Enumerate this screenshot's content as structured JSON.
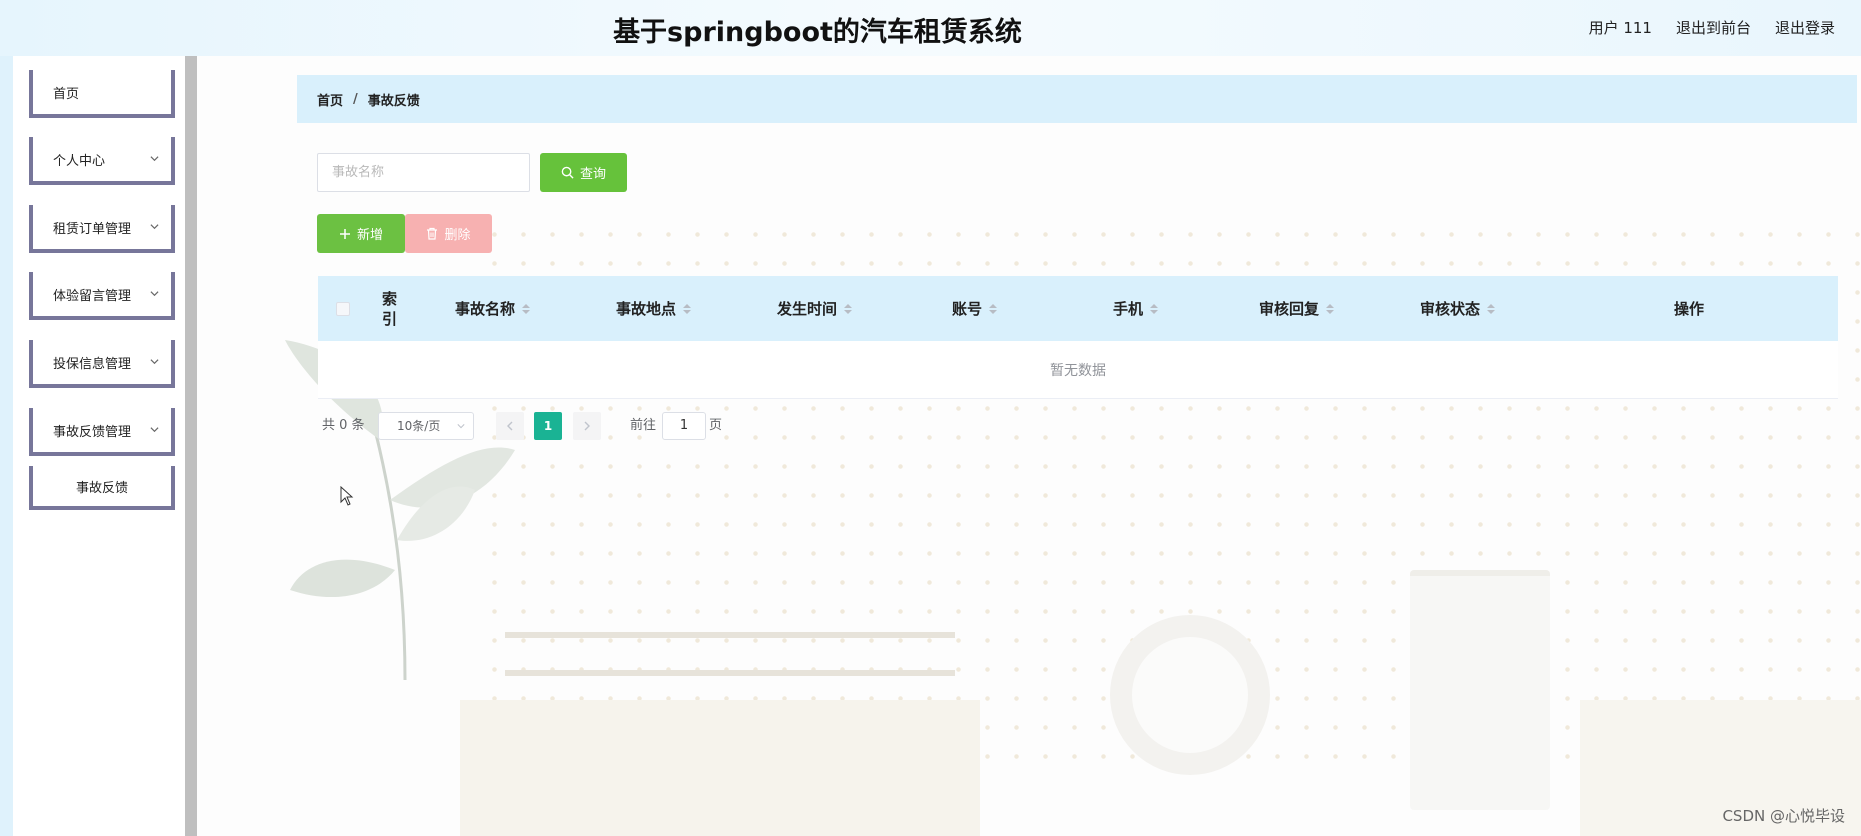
{
  "header": {
    "title": "基于springboot的汽车租赁系统",
    "user": "用户 111",
    "to_frontend": "退出到前台",
    "logout": "退出登录"
  },
  "sidebar": {
    "items": [
      {
        "label": "首页",
        "has_submenu": false
      },
      {
        "label": "个人中心",
        "has_submenu": true
      },
      {
        "label": "租赁订单管理",
        "has_submenu": true
      },
      {
        "label": "体验留言管理",
        "has_submenu": true
      },
      {
        "label": "投保信息管理",
        "has_submenu": true
      },
      {
        "label": "事故反馈管理",
        "has_submenu": true
      }
    ],
    "sub_item": "事故反馈"
  },
  "breadcrumb": {
    "home": "首页",
    "separator": "/",
    "current": "事故反馈"
  },
  "search": {
    "placeholder": "事故名称",
    "query_label": "查询"
  },
  "actions": {
    "add_label": "新增",
    "delete_label": "删除"
  },
  "table": {
    "columns": {
      "index": "索引",
      "name": "事故名称",
      "location": "事故地点",
      "time": "发生时间",
      "account": "账号",
      "phone": "手机",
      "reply": "审核回复",
      "status": "审核状态",
      "ops": "操作"
    },
    "empty_text": "暂无数据"
  },
  "pagination": {
    "total": "共 0 条",
    "page_size": "10条/页",
    "current_page": "1",
    "goto_label": "前往",
    "goto_value": "1",
    "page_unit": "页"
  },
  "watermark": "CSDN @心悦毕设",
  "colors": {
    "primary_green": "#66c23b",
    "danger_light": "#f7b1b1",
    "pager_active": "#1ab394",
    "header_bg": "#d9f0fc",
    "menu_border": "#77769a"
  }
}
